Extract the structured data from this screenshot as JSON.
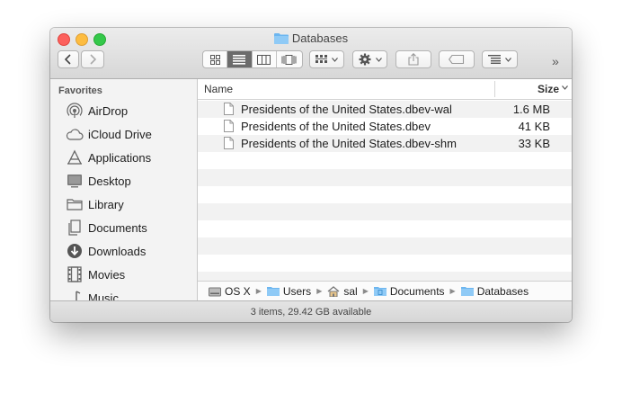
{
  "window": {
    "title": "Databases"
  },
  "toolbar": {
    "nav": [
      "back",
      "forward"
    ],
    "view_modes": [
      "icon-view",
      "list-view",
      "column-view",
      "cover-flow-view"
    ],
    "active_view": "list-view",
    "overflow_label": "»"
  },
  "sidebar": {
    "heading": "Favorites",
    "items": [
      {
        "label": "AirDrop",
        "icon": "airdrop-icon"
      },
      {
        "label": "iCloud Drive",
        "icon": "cloud-icon"
      },
      {
        "label": "Applications",
        "icon": "applications-icon"
      },
      {
        "label": "Desktop",
        "icon": "desktop-icon"
      },
      {
        "label": "Library",
        "icon": "folder-icon"
      },
      {
        "label": "Documents",
        "icon": "documents-icon"
      },
      {
        "label": "Downloads",
        "icon": "downloads-icon"
      },
      {
        "label": "Movies",
        "icon": "movies-icon"
      },
      {
        "label": "Music",
        "icon": "music-icon"
      }
    ]
  },
  "list": {
    "columns": {
      "name": "Name",
      "size": "Size"
    },
    "files": [
      {
        "name": "Presidents of the United States.dbev-wal",
        "size": "1.6 MB"
      },
      {
        "name": "Presidents of the United States.dbev",
        "size": "41 KB"
      },
      {
        "name": "Presidents of the United States.dbev-shm",
        "size": "33 KB"
      }
    ]
  },
  "pathbar": {
    "crumbs": [
      {
        "label": "OS X",
        "icon": "hard-drive-icon"
      },
      {
        "label": "Users",
        "icon": "folder-icon"
      },
      {
        "label": "sal",
        "icon": "home-icon"
      },
      {
        "label": "Documents",
        "icon": "documents-folder-icon"
      },
      {
        "label": "Databases",
        "icon": "folder-icon"
      }
    ]
  },
  "status": {
    "text": "3 items, 29.42 GB available"
  },
  "colors": {
    "accent_folder": "#6cb6f0",
    "active_segment": "#6b6b6b"
  }
}
